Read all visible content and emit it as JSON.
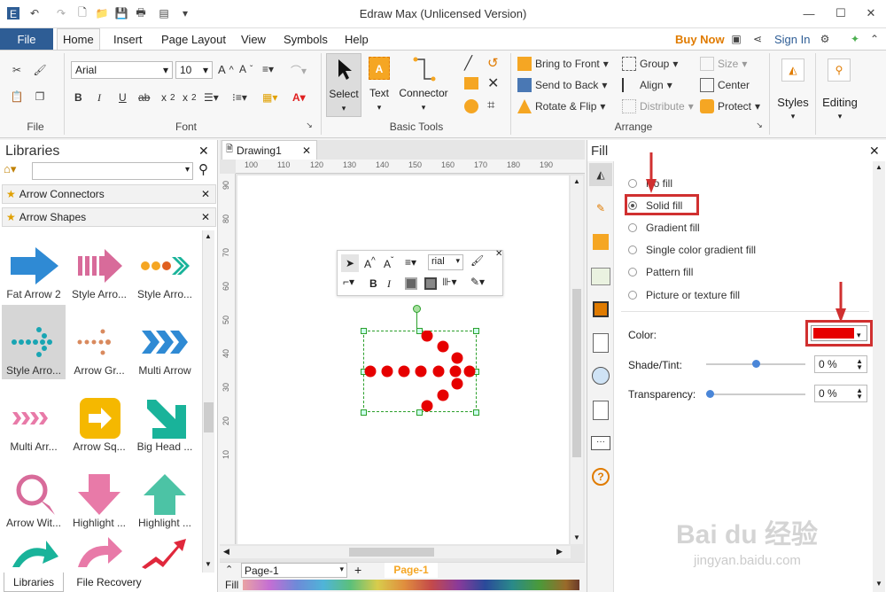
{
  "window": {
    "title": "Edraw Max (Unlicensed Version)",
    "colors": {
      "accent": "#2e5d95",
      "red": "#e02020",
      "buy": "#e07b00"
    }
  },
  "menu": {
    "file": "File",
    "home": "Home",
    "insert": "Insert",
    "page_layout": "Page Layout",
    "view": "View",
    "symbols": "Symbols",
    "help": "Help",
    "buy_now": "Buy Now",
    "sign_in": "Sign In"
  },
  "ribbon": {
    "file_label": "File",
    "font": {
      "name": "Arial",
      "size": "10",
      "label": "Font"
    },
    "basic_tools": {
      "select": "Select",
      "text": "Text",
      "connector": "Connector",
      "label": "Basic Tools"
    },
    "arrange": {
      "bring_front": "Bring to Front",
      "send_back": "Send to Back",
      "rotate_flip": "Rotate & Flip",
      "group": "Group",
      "align": "Align",
      "distribute": "Distribute",
      "size": "Size",
      "center": "Center",
      "protect": "Protect",
      "label": "Arrange"
    },
    "styles": "Styles",
    "editing": "Editing"
  },
  "libraries": {
    "title": "Libraries",
    "categories": [
      "Arrow Connectors",
      "Arrow Shapes"
    ],
    "shapes": [
      "Fat Arrow 2",
      "Style Arro...",
      "Style Arro...",
      "Style Arro...",
      "Arrow Gr...",
      "Multi Arrow",
      "Multi Arr...",
      "Arrow Sq...",
      "Big Head ...",
      "Arrow Wit...",
      "Highlight ...",
      "Highlight ..."
    ],
    "bottom_tabs": [
      "Libraries",
      "File Recovery"
    ]
  },
  "document": {
    "tab": "Drawing1",
    "ruler_h": [
      "100",
      "110",
      "120",
      "130",
      "140",
      "150",
      "160",
      "170",
      "180",
      "190"
    ],
    "ruler_v": [
      "90",
      "80",
      "70",
      "60",
      "50",
      "40",
      "30",
      "20",
      "10"
    ],
    "page": "Page-1",
    "page_tab": "Page-1",
    "fill_label": "Fill"
  },
  "mini_toolbar": {
    "font": "rial"
  },
  "fill": {
    "title": "Fill",
    "options": [
      "No fill",
      "Solid fill",
      "Gradient fill",
      "Single color gradient fill",
      "Pattern fill",
      "Picture or texture fill"
    ],
    "selected": "Solid fill",
    "color_label": "Color:",
    "color_value": "#e60000",
    "shade_label": "Shade/Tint:",
    "shade_value": "0 %",
    "transparency_label": "Transparency:",
    "transparency_value": "0 %"
  },
  "watermark": {
    "brand": "Bai du 经验",
    "url": "jingyan.baidu.com"
  }
}
